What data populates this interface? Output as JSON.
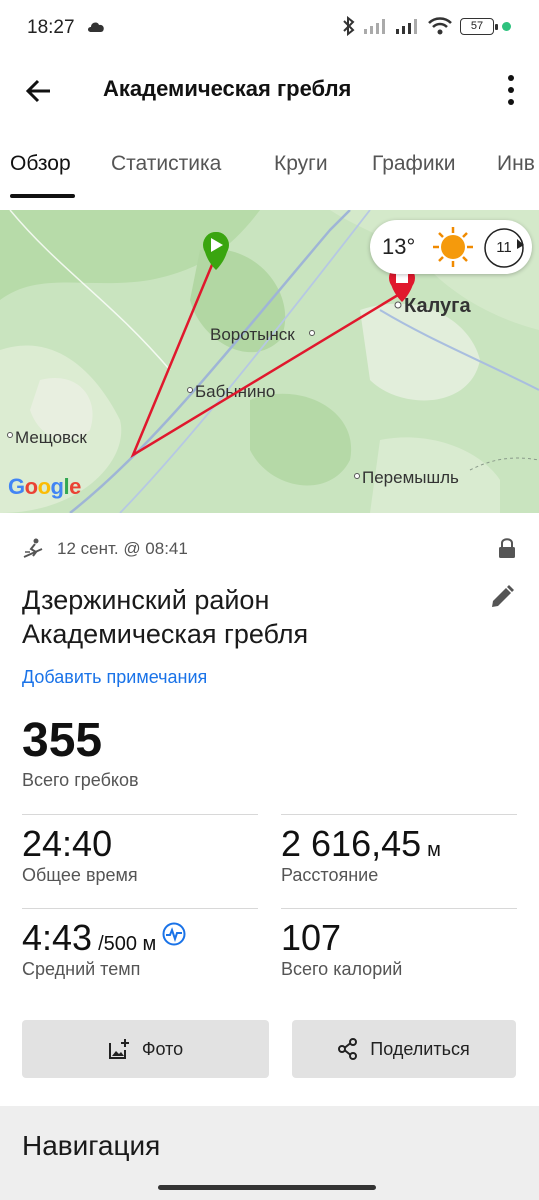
{
  "status_bar": {
    "time": "18:27",
    "battery": "57"
  },
  "app_bar": {
    "title": "Академическая гребля"
  },
  "tabs": [
    {
      "label": "Обзор",
      "active": true
    },
    {
      "label": "Статистика",
      "active": false
    },
    {
      "label": "Круги",
      "active": false
    },
    {
      "label": "Графики",
      "active": false
    },
    {
      "label": "Инв",
      "active": false
    }
  ],
  "map": {
    "weather": {
      "temperature": "13°",
      "wind_speed": "11"
    },
    "places": [
      "Калуга",
      "Воротынск",
      "Бабынино",
      "Мещовск",
      "Перемышль"
    ],
    "route_color": "#e0182d",
    "start_color": "#3aa510",
    "attribution": "Google"
  },
  "activity": {
    "date": "12 сент. @ 08:41",
    "name_line1": "Дзержинский район",
    "name_line2": "Академическая гребля",
    "add_notes": "Добавить примечания",
    "total_strokes": {
      "value": "355",
      "label": "Всего гребков"
    },
    "stats": [
      {
        "value": "24:40",
        "unit": "",
        "label": "Общее время"
      },
      {
        "value": "2 616,45",
        "unit": "м",
        "label": "Расстояние"
      },
      {
        "value": "4:43",
        "unit": "/500 м",
        "label": "Средний темп"
      },
      {
        "value": "107",
        "unit": "",
        "label": "Всего калорий"
      }
    ]
  },
  "buttons": {
    "photo": "Фото",
    "share": "Поделиться"
  },
  "navigation": {
    "title": "Навигация"
  },
  "colors": {
    "link": "#1a73e8",
    "map_green": "#cfe8c6"
  }
}
